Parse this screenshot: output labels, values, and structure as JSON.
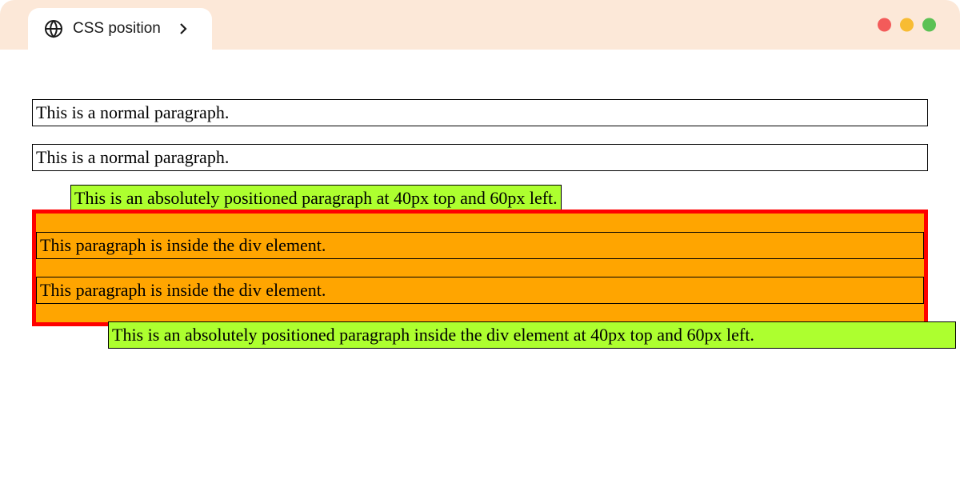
{
  "tab": {
    "title": "CSS position"
  },
  "content": {
    "para1": "This is a normal paragraph.",
    "para2": "This is a normal paragraph.",
    "absPara": "This is an absolutely positioned paragraph at 40px top and 60px left.",
    "div": {
      "para1": "This paragraph is inside the div element.",
      "para2": "This paragraph is inside the div element.",
      "absPara": "This is an absolutely positioned paragraph inside the div element at 40px top and 60px left."
    }
  },
  "colors": {
    "tabBar": "#fce8d8",
    "absParaBg": "#adff2f",
    "divBg": "orange",
    "divBorder": "red"
  }
}
